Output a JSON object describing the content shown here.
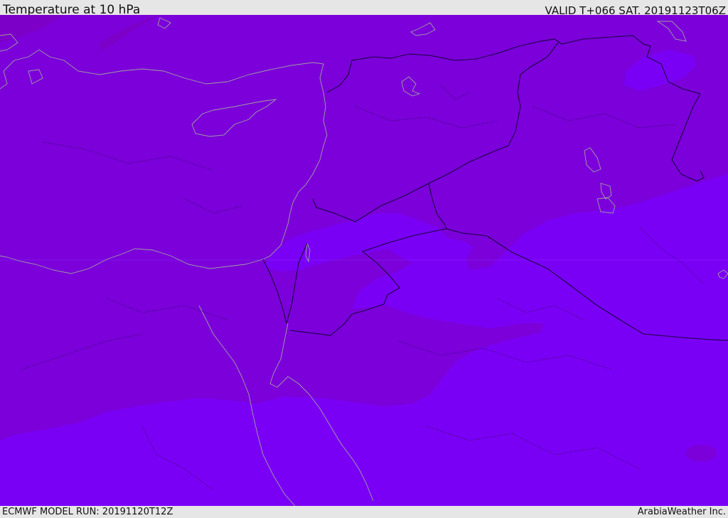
{
  "header": {
    "title": "Temperature at 10 hPa",
    "valid_time": "VALID T+066 SAT. 20191123T06Z"
  },
  "footer": {
    "model_run": "ECMWF MODEL RUN: 20191120T12Z",
    "credit": "ArabiaWeather Inc."
  },
  "map": {
    "colors": {
      "warm_band": "#7b00da",
      "cold_band": "#7a00f5",
      "warmest_patch": "#7d00c8",
      "political_border": "#1a0040",
      "coastline": "#a0a0a0",
      "admin_border": "#3a0a70"
    }
  }
}
